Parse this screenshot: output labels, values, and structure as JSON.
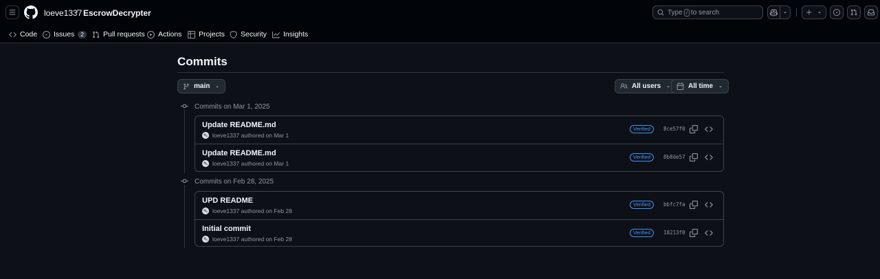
{
  "header": {
    "owner": "loeve1337",
    "separator": "/",
    "repo": "EscrowDecrypter",
    "search_prefix": "Type",
    "search_key": "/",
    "search_suffix": "to search"
  },
  "repo_nav": {
    "items": [
      {
        "label": "Code",
        "icon": "code-icon"
      },
      {
        "label": "Issues",
        "icon": "issue-opened-icon",
        "count": "2"
      },
      {
        "label": "Pull requests",
        "icon": "git-pull-request-icon"
      },
      {
        "label": "Actions",
        "icon": "play-icon"
      },
      {
        "label": "Projects",
        "icon": "table-icon"
      },
      {
        "label": "Security",
        "icon": "shield-icon"
      },
      {
        "label": "Insights",
        "icon": "graph-icon"
      }
    ]
  },
  "page": {
    "title": "Commits"
  },
  "filters": {
    "branch": "main",
    "users": "All users",
    "time": "All time"
  },
  "groups": [
    {
      "heading": "Commits on Mar 1, 2025",
      "commits": [
        {
          "message": "Update README.md",
          "author": "loeve1337",
          "action": "authored on Mar 1",
          "badge": "Verified",
          "sha": "8ce57f0"
        },
        {
          "message": "Update README.md",
          "author": "loeve1337",
          "action": "authored on Mar 1",
          "badge": "Verified",
          "sha": "8b8de57"
        }
      ]
    },
    {
      "heading": "Commits on Feb 28, 2025",
      "commits": [
        {
          "message": "UPD README",
          "author": "loeve1337",
          "action": "authored on Feb 28",
          "badge": "Verified",
          "sha": "bbfc7fa"
        },
        {
          "message": "Initial commit",
          "author": "loeve1337",
          "action": "authored on Feb 28",
          "badge": "Verified",
          "sha": "18213f0"
        }
      ]
    }
  ],
  "colors": {
    "background": "#0d1117",
    "header_bg": "#010409",
    "border": "#3d444d",
    "accent": "#4493f8",
    "muted": "#9198a1"
  }
}
